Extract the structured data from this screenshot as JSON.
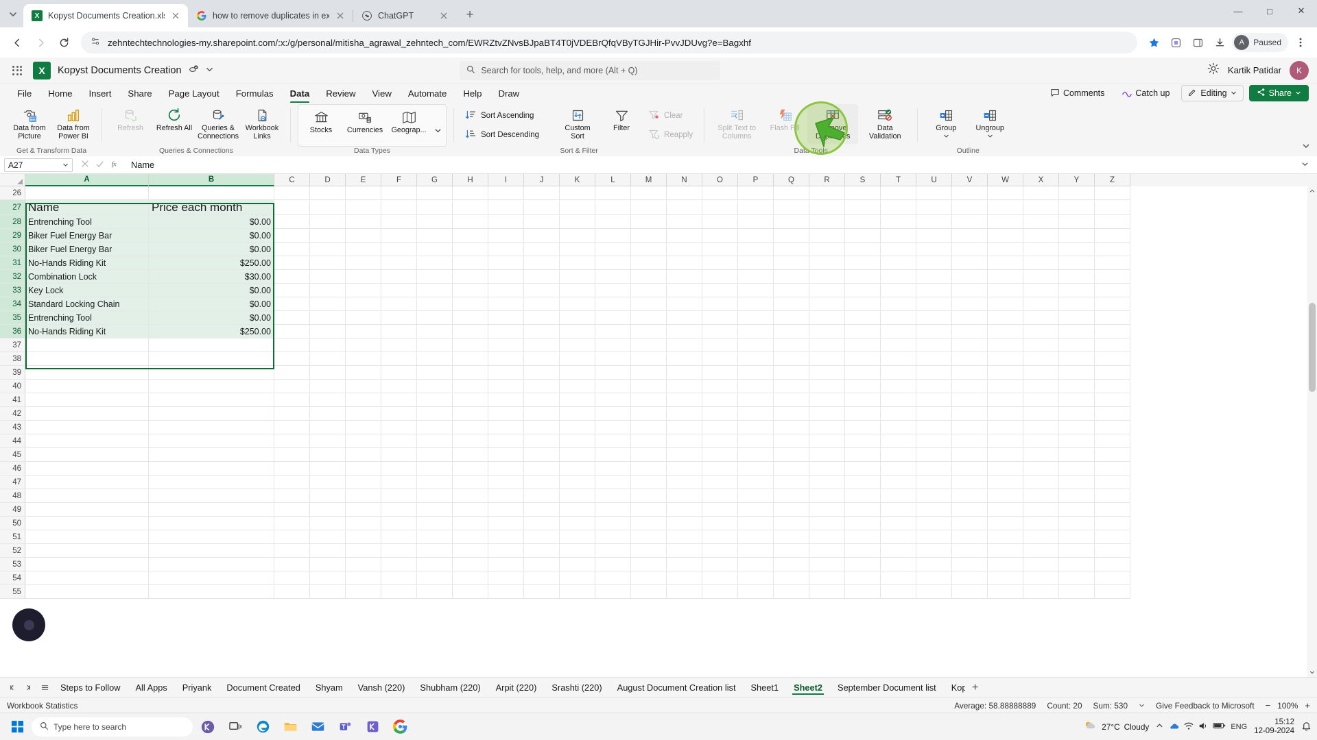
{
  "browser": {
    "tabs": [
      {
        "title": "Kopyst Documents Creation.xlsx",
        "favicon": "excel-icon",
        "active": true
      },
      {
        "title": "how to remove duplicates in ex",
        "favicon": "google-icon",
        "active": false
      },
      {
        "title": "ChatGPT",
        "favicon": "chatgpt-icon",
        "active": false
      }
    ],
    "new_tab_label": "+",
    "url": "zehntechtechnologies-my.sharepoint.com/:x:/g/personal/mitisha_agrawal_zehntech_com/EWRZtvZNvsBJpaBT4T0jVDEBrQfqVByTGJHir-PvvJDUvg?e=Bagxhf",
    "profile_label": "Paused",
    "profile_initial": "A",
    "window_controls": {
      "minimize": "—",
      "maximize": "□",
      "close": "✕"
    }
  },
  "excel_header": {
    "document_title": "Kopyst Documents Creation",
    "search_placeholder": "Search for tools, help, and more (Alt + Q)",
    "user_name": "Kartik Patidar",
    "user_initial": "K"
  },
  "ribbon": {
    "tabs": [
      "File",
      "Home",
      "Insert",
      "Share",
      "Page Layout",
      "Formulas",
      "Data",
      "Review",
      "View",
      "Automate",
      "Help",
      "Draw"
    ],
    "active_tab": "Data",
    "right_actions": {
      "comments": "Comments",
      "catch_up": "Catch up",
      "editing": "Editing",
      "share": "Share"
    },
    "groups": [
      {
        "name": "Get & Transform Data",
        "buttons": [
          {
            "label": "Data from Picture",
            "icon": "camera-table-icon",
            "disabled": false
          },
          {
            "label": "Data from Power BI",
            "icon": "power-bi-icon",
            "disabled": false
          }
        ]
      },
      {
        "name": "Queries & Connections",
        "buttons": [
          {
            "label": "Refresh",
            "icon": "refresh-icon",
            "disabled": true
          },
          {
            "label": "Refresh All",
            "icon": "refresh-all-icon",
            "disabled": false
          },
          {
            "label": "Queries & Connections",
            "icon": "queries-connections-icon",
            "disabled": false
          },
          {
            "label": "Workbook Links",
            "icon": "workbook-links-icon",
            "disabled": false
          }
        ]
      },
      {
        "name": "Data Types",
        "buttons": [
          {
            "label": "Stocks",
            "icon": "bank-icon",
            "disabled": false
          },
          {
            "label": "Currencies",
            "icon": "currency-icon",
            "disabled": false
          },
          {
            "label": "Geograp...",
            "icon": "map-icon",
            "disabled": false
          }
        ]
      },
      {
        "name": "Sort & Filter",
        "buttons": [
          {
            "label": "Sort Ascending",
            "icon": "sort-ascending-icon",
            "disabled": false
          },
          {
            "label": "Sort Descending",
            "icon": "sort-descending-icon",
            "disabled": false
          },
          {
            "label": "Custom Sort",
            "icon": "custom-sort-icon",
            "disabled": false
          },
          {
            "label": "Filter",
            "icon": "filter-icon",
            "disabled": false
          },
          {
            "label": "Clear",
            "icon": "clear-filter-icon",
            "disabled": true
          },
          {
            "label": "Reapply",
            "icon": "reapply-filter-icon",
            "disabled": true
          }
        ]
      },
      {
        "name": "Data Tools",
        "buttons": [
          {
            "label": "Split Text to Columns",
            "icon": "split-text-icon",
            "disabled": true
          },
          {
            "label": "Flash Fill",
            "icon": "flash-fill-icon",
            "disabled": true
          },
          {
            "label": "Remove Duplicates",
            "icon": "remove-duplicates-icon",
            "disabled": false,
            "highlighted": true
          },
          {
            "label": "Data Validation",
            "icon": "data-validation-icon",
            "disabled": false
          }
        ]
      },
      {
        "name": "Outline",
        "buttons": [
          {
            "label": "Group",
            "icon": "group-icon",
            "disabled": false
          },
          {
            "label": "Ungroup",
            "icon": "ungroup-icon",
            "disabled": false
          }
        ]
      }
    ]
  },
  "formula_bar": {
    "name_box": "A27",
    "formula_value": "Name",
    "cancel_icon": "cancel-icon",
    "confirm_icon": "confirm-icon",
    "function_icon": "insert-function-icon"
  },
  "grid": {
    "columns": [
      "A",
      "B",
      "C",
      "D",
      "E",
      "F",
      "G",
      "H",
      "I",
      "J",
      "K",
      "L",
      "M",
      "N",
      "O",
      "P",
      "Q",
      "R",
      "S",
      "T",
      "U",
      "V",
      "W",
      "X",
      "Y",
      "Z"
    ],
    "selected_columns": [
      "A",
      "B"
    ],
    "first_visible_row": 26,
    "last_visible_row": 55,
    "selection_range_rows": [
      27,
      36
    ],
    "table": {
      "headers": [
        "Name",
        "Price each month"
      ],
      "rows": [
        {
          "row": 28,
          "name": "Entrenching Tool",
          "price": "$0.00"
        },
        {
          "row": 29,
          "name": "Biker Fuel Energy Bar",
          "price": "$0.00"
        },
        {
          "row": 30,
          "name": "Biker Fuel Energy Bar",
          "price": "$0.00"
        },
        {
          "row": 31,
          "name": "No-Hands Riding Kit",
          "price": "$250.00"
        },
        {
          "row": 32,
          "name": "Combination Lock",
          "price": "$30.00"
        },
        {
          "row": 33,
          "name": "Key Lock",
          "price": "$0.00"
        },
        {
          "row": 34,
          "name": "Standard Locking Chain",
          "price": "$0.00"
        },
        {
          "row": 35,
          "name": "Entrenching Tool",
          "price": "$0.00"
        },
        {
          "row": 36,
          "name": "No-Hands Riding Kit",
          "price": "$250.00"
        }
      ]
    }
  },
  "sheet_tabs": {
    "items": [
      "Steps to Follow",
      "All Apps",
      "Priyank",
      "Document Created",
      "Shyam",
      "Vansh (220)",
      "Shubham (220)",
      "Arpit (220)",
      "Srashti (220)",
      "August Document Creation list",
      "Sheet1",
      "Sheet2",
      "September Document list",
      "Kop"
    ],
    "active": "Sheet2",
    "add_label": "+"
  },
  "status_bar": {
    "left_label": "Workbook Statistics",
    "average": "Average: 58.88888889",
    "count": "Count: 20",
    "sum": "Sum: 530",
    "feedback": "Give Feedback to Microsoft",
    "zoom": "100%"
  },
  "taskbar": {
    "search_placeholder": "Type here to search",
    "weather_temp": "27°C",
    "weather_desc": "Cloudy",
    "language": "ENG",
    "time": "15:12",
    "date": "12-09-2024"
  },
  "colors": {
    "excel_green": "#107c41",
    "selection_green": "#0b6b35",
    "selection_fill": "#e2f0e7",
    "header_selected": "#cfe8d7",
    "highlight_ring": "#8cc63f"
  }
}
